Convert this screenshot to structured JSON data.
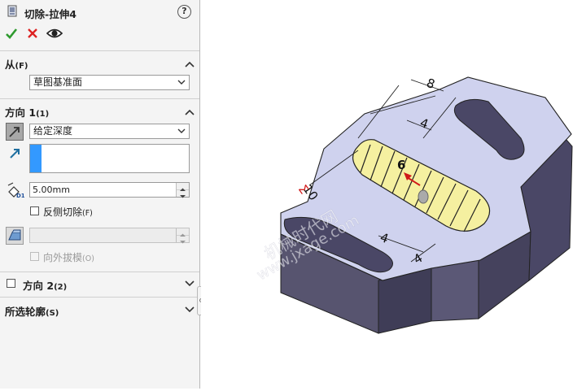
{
  "header": {
    "title": "切除-拉伸4",
    "help_label": "?"
  },
  "toolbar": {
    "ok_icon": "check-icon",
    "cancel_icon": "close-icon",
    "preview_icon": "eye-icon"
  },
  "from_section": {
    "label": "从",
    "shortcut": "(F)",
    "value": "草图基准面"
  },
  "direction1": {
    "label": "方向 1",
    "shortcut": "(1)",
    "end_condition": "给定深度",
    "depth": "5.00mm",
    "flip_side_label": "反侧切除",
    "flip_side_shortcut": "(F)",
    "flip_side_checked": false,
    "draft_value": "",
    "draft_outward_label": "向外拔模",
    "draft_outward_shortcut": "(O)"
  },
  "direction2": {
    "label": "方向 2",
    "shortcut": "(2)",
    "checked": false
  },
  "selected_contours": {
    "label": "所选轮廓",
    "shortcut": "(S)"
  },
  "viewport": {
    "dimensions": [
      "8",
      "4",
      "10",
      "6",
      "4",
      "4"
    ],
    "watermark_line1": "机械时代网",
    "watermark_line2": "www.jxage.com"
  },
  "colors": {
    "accent": "#3399ff",
    "part_top": "#cfd2ee",
    "part_side": "#4a4766",
    "sketch_fill": "#f5f0a0"
  }
}
